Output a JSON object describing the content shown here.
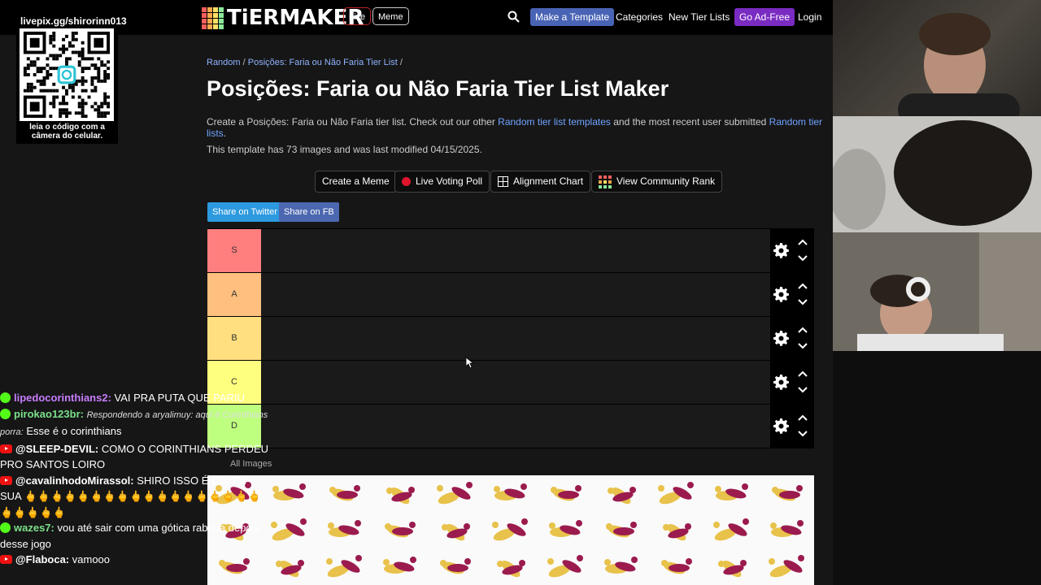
{
  "header": {
    "logo": "TiERMAKER",
    "live_label": "Live",
    "meme_label": "Meme",
    "make_template": "Make a Template",
    "categories": "Categories",
    "new_tier_lists": "New Tier Lists",
    "ad_free": "Go Ad-Free",
    "login": "Login",
    "logo_colors": [
      "#f25f5c",
      "#ffa94d",
      "#ffe066",
      "#8ce99a",
      "#f25f5c",
      "#ffa94d",
      "#ffe066",
      "#8ce99a",
      "#f25f5c",
      "#ffa94d",
      "#ffe066",
      "#8ce99a",
      "#f25f5c",
      "#ffa94d",
      "#ffe066",
      "#8ce99a"
    ]
  },
  "breadcrumb": {
    "random": "Random",
    "sep1": " / ",
    "page": "Posições: Faria ou Não Faria Tier List",
    "sep2": " /"
  },
  "page": {
    "title": "Posições: Faria ou Não Faria Tier List Maker",
    "desc_1": "Create a Posições: Faria ou Não Faria tier list. Check out our other ",
    "desc_link_1": "Random tier list templates",
    "desc_2": " and the most recent user submitted ",
    "desc_link_2": "Random tier lists",
    "desc_3": ".",
    "meta": "This template has 73 images and was last modified 04/15/2025."
  },
  "actions": {
    "create_meme": "Create a Meme",
    "live_poll": "Live Voting Poll",
    "alignment": "Alignment Chart",
    "community": "View Community Rank"
  },
  "share": {
    "twitter": "Share on Twitter",
    "fb": "Share on FB"
  },
  "tiers": [
    {
      "label": "S",
      "color": "#ff7f7f"
    },
    {
      "label": "A",
      "color": "#ffbf7f"
    },
    {
      "label": "B",
      "color": "#ffdf7f"
    },
    {
      "label": "C",
      "color": "#ffff7f"
    },
    {
      "label": "D",
      "color": "#bfff7f"
    }
  ],
  "images_label": "All Images",
  "qr": {
    "url": "livepix.gg/shirorinn013",
    "caption_1": "leia o código com a",
    "caption_2": "câmera do celular."
  },
  "chat": [
    {
      "platform": "kick",
      "user": "lipedocorinthians2:",
      "user_color": "#c77dff",
      "text": "VAI PRA PUTA QUE PARIU"
    },
    {
      "platform": "kick",
      "user": "pirokao123br:",
      "user_color": "#7be08a",
      "reply": "Respondendo a aryalimuy: aqui é Corinthians porra:",
      "text": "Esse é o corinthians"
    },
    {
      "platform": "youtube",
      "user": "@SLEEP-DEVIL:",
      "user_color": "#ffffff",
      "text": "COMO O CORINTHIANS PERDEU PRO SANTOS LOIRO"
    },
    {
      "platform": "youtube",
      "user": "@cavalinhodoMirassol:",
      "user_color": "#ffffff",
      "text": "SHIRO ISSO É CULPA SUA 🖕🖕🖕🖕🖕🖕🖕🖕🖕🖕🖕🖕🖕🖕🖕🖕🖕🖕🖕🖕🖕🖕🖕"
    },
    {
      "platform": "kick",
      "user": "wazes7:",
      "user_color": "#7be08a",
      "text": "vou até sair com uma gótica raboda depois desse jogo"
    },
    {
      "platform": "youtube",
      "user": "@Flaboca:",
      "user_color": "#ffffff",
      "text": "vamooo"
    }
  ]
}
